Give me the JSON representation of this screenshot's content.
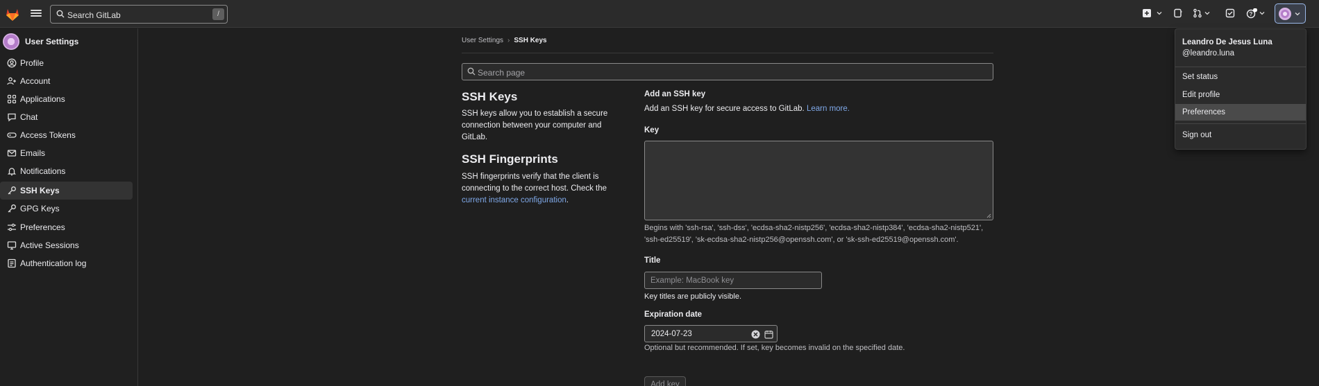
{
  "topbar": {
    "search_placeholder": "Search GitLab",
    "search_shortcut": "/",
    "icons": [
      "tanuki-logo-icon",
      "hamburger-icon",
      "search-icon",
      "plus-icon",
      "issues-icon",
      "merge-request-icon",
      "todo-icon",
      "help-icon",
      "avatar"
    ]
  },
  "sidebar": {
    "title": "User Settings",
    "items": [
      {
        "label": "Profile",
        "icon": "profile-icon"
      },
      {
        "label": "Account",
        "icon": "account-icon"
      },
      {
        "label": "Applications",
        "icon": "applications-icon"
      },
      {
        "label": "Chat",
        "icon": "chat-icon"
      },
      {
        "label": "Access Tokens",
        "icon": "token-icon"
      },
      {
        "label": "Emails",
        "icon": "mail-icon"
      },
      {
        "label": "Notifications",
        "icon": "bell-icon"
      },
      {
        "label": "SSH Keys",
        "icon": "key-icon",
        "active": true
      },
      {
        "label": "GPG Keys",
        "icon": "key-icon"
      },
      {
        "label": "Preferences",
        "icon": "preferences-icon"
      },
      {
        "label": "Active Sessions",
        "icon": "monitor-icon"
      },
      {
        "label": "Authentication log",
        "icon": "log-icon"
      }
    ]
  },
  "breadcrumb": {
    "parent": "User Settings",
    "current": "SSH Keys"
  },
  "page_search": {
    "placeholder": "Search page"
  },
  "ssh_keys": {
    "heading": "SSH Keys",
    "description": "SSH keys allow you to establish a secure connection between your computer and GitLab."
  },
  "fingerprints": {
    "heading": "SSH Fingerprints",
    "description": "SSH fingerprints verify that the client is connecting to the correct host. Check the",
    "link": "current instance configuration",
    "period": "."
  },
  "form": {
    "heading": "Add an SSH key",
    "intro": "Add an SSH key for secure access to GitLab.",
    "learn_more": "Learn more.",
    "key_label": "Key",
    "key_help_1": "Begins with 'ssh-rsa', 'ssh-dss', 'ecdsa-sha2-nistp256', 'ecdsa-sha2-nistp384', 'ecdsa-sha2-nistp521',",
    "key_help_2": "'ssh-ed25519', 'sk-ecdsa-sha2-nistp256@openssh.com', or 'sk-ssh-ed25519@openssh.com'.",
    "title_label": "Title",
    "title_placeholder": "Example: MacBook key",
    "title_help": "Key titles are publicly visible.",
    "expiration_label": "Expiration date",
    "expiration_value": "2024-07-23",
    "expiration_help": "Optional but recommended. If set, key becomes invalid on the specified date.",
    "submit_label": "Add key"
  },
  "user_menu": {
    "name": "Leandro De Jesus Luna",
    "username": "@leandro.luna",
    "items": [
      "Set status",
      "Edit profile",
      "Preferences"
    ],
    "sign_out": "Sign out"
  },
  "colors": {
    "accent": "#7fa8e8",
    "background": "#1f1f1f",
    "logo": "#e24329"
  }
}
